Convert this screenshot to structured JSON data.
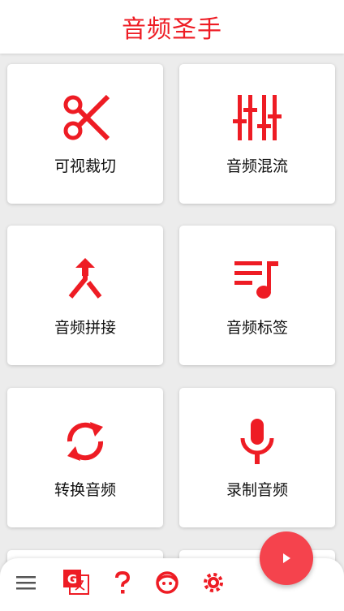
{
  "app": {
    "title": "音频圣手"
  },
  "accent_color": "#ee1c24",
  "fab_color": "#f5434d",
  "tiles": [
    {
      "label": "可视裁切",
      "icon": "scissors-icon"
    },
    {
      "label": "音频混流",
      "icon": "equalizer-sliders-icon"
    },
    {
      "label": "音频拼接",
      "icon": "merge-arrow-icon"
    },
    {
      "label": "音频标签",
      "icon": "playlist-music-icon"
    },
    {
      "label": "转换音频",
      "icon": "sync-arrows-icon"
    },
    {
      "label": "录制音频",
      "icon": "microphone-icon"
    }
  ],
  "bottom_nav": [
    {
      "icon": "menu-icon"
    },
    {
      "icon": "translate-icon"
    },
    {
      "icon": "help-icon"
    },
    {
      "icon": "face-icon"
    },
    {
      "icon": "settings-icon"
    }
  ],
  "fab": {
    "icon": "play-icon"
  }
}
